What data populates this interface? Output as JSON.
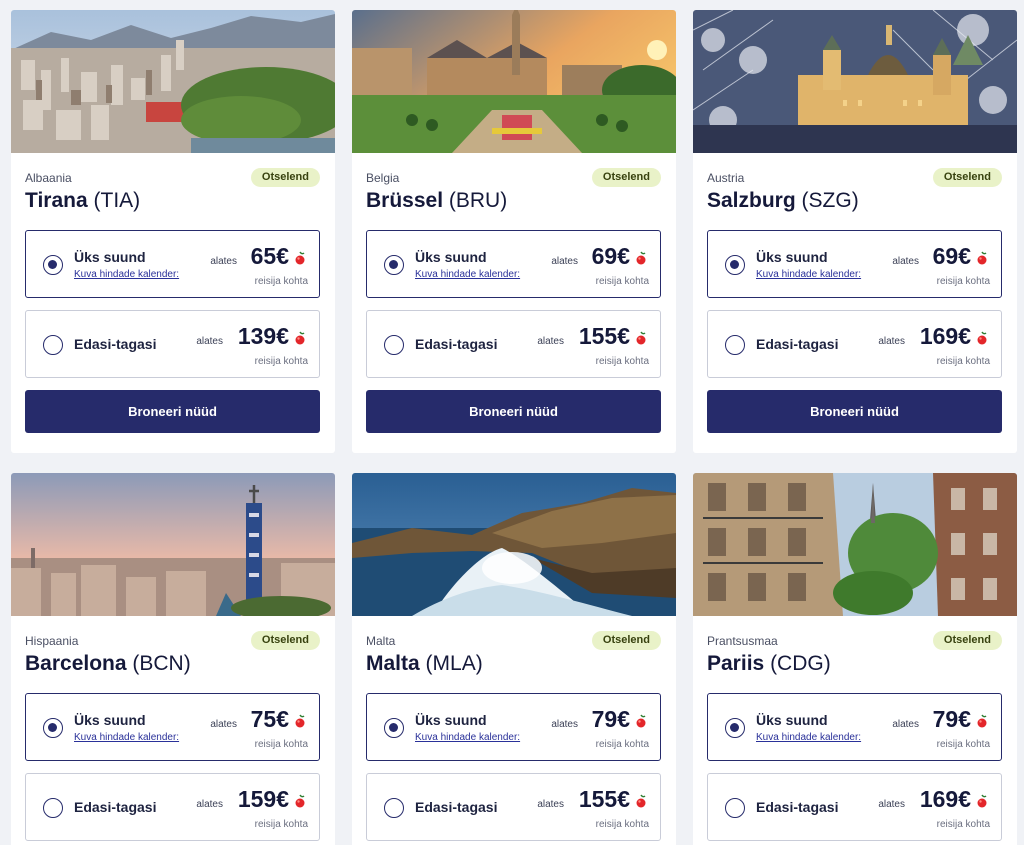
{
  "common": {
    "badge": "Otselend",
    "one_way_label": "Üks suund",
    "calendar_link": "Kuva hindade kalender:",
    "return_label": "Edasi-tagasi",
    "from_label": "alates",
    "per_person": "reisija kohta",
    "book_button": "Broneeri nüüd"
  },
  "cards": [
    {
      "country": "Albaania",
      "city": "Tirana",
      "code": "(TIA)",
      "one_way_price": "65€",
      "return_price": "139€",
      "image": "tirana-cityscape"
    },
    {
      "country": "Belgia",
      "city": "Brüssel",
      "code": "(BRU)",
      "one_way_price": "69€",
      "return_price": "155€",
      "image": "brussels-garden"
    },
    {
      "country": "Austria",
      "city": "Salzburg",
      "code": "(SZG)",
      "one_way_price": "69€",
      "return_price": "169€",
      "image": "salzburg-winter"
    },
    {
      "country": "Hispaania",
      "city": "Barcelona",
      "code": "(BCN)",
      "one_way_price": "75€",
      "return_price": "159€",
      "image": "barcelona-skyline"
    },
    {
      "country": "Malta",
      "city": "Malta",
      "code": "(MLA)",
      "one_way_price": "79€",
      "return_price": "155€",
      "image": "malta-coast-waves"
    },
    {
      "country": "Prantsusmaa",
      "city": "Pariis",
      "code": "(CDG)",
      "one_way_price": "79€",
      "return_price": "169€",
      "image": "paris-street-eiffel"
    }
  ],
  "colors": {
    "primary": "#262b6b",
    "badge_bg": "#e9f2c8",
    "page_bg": "#f0f2f6",
    "cherry": "#e3262a"
  }
}
